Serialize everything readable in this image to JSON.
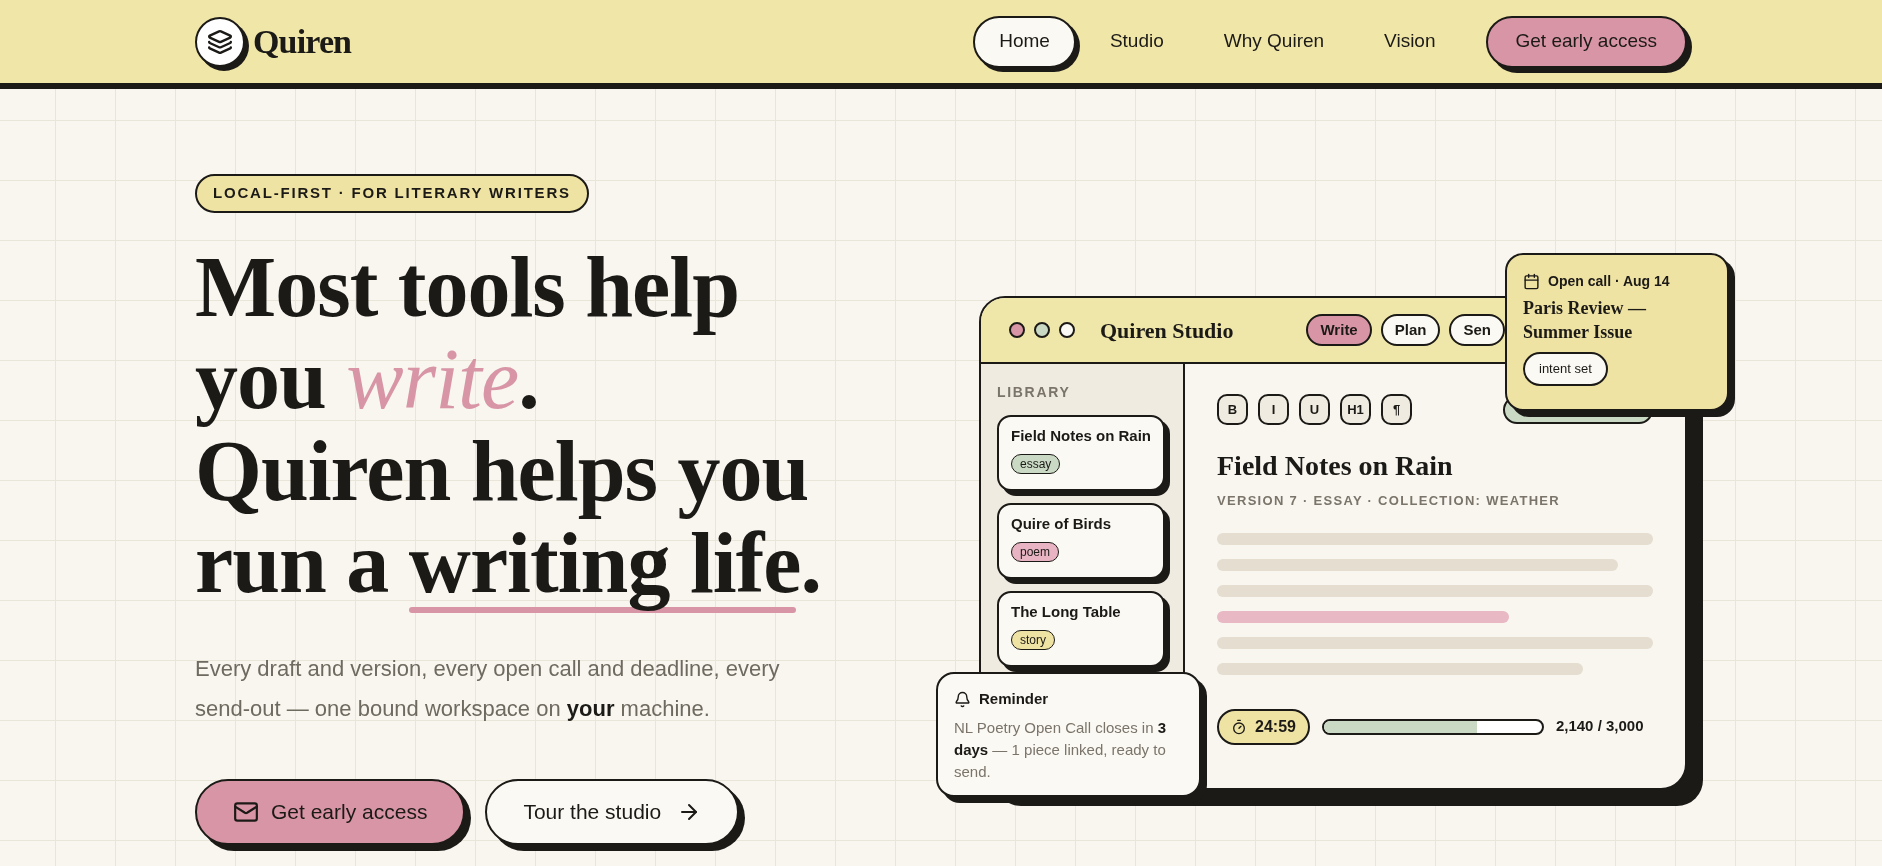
{
  "brand": {
    "name": "Quiren"
  },
  "nav": [
    {
      "label": "Home",
      "selected": true
    },
    {
      "label": "Studio",
      "selected": false
    },
    {
      "label": "Why Quiren",
      "selected": false
    },
    {
      "label": "Vision",
      "selected": false
    }
  ],
  "nav_cta": "Get early access",
  "hero": {
    "badge": "LOCAL-FIRST · FOR LITERARY WRITERS",
    "headline": [
      [
        {
          "text": "Most tools help you ",
          "kind": "plain"
        },
        {
          "text": "write",
          "kind": "accent"
        },
        {
          "text": ".",
          "kind": "plain"
        }
      ],
      [
        {
          "text": "Quiren helps you run a ",
          "kind": "plain"
        },
        {
          "text": "writing life",
          "kind": "underline"
        },
        {
          "text": ".",
          "kind": "plain"
        }
      ]
    ],
    "lead": "Every draft and version, every open call and deadline, every send-out — one bound workspace on **your** machine.",
    "buttons": [
      {
        "label": "Get early access",
        "kind": "primary"
      },
      {
        "label": "Tour the studio",
        "kind": "secondary"
      }
    ]
  },
  "studio": {
    "title": "Quiren Studio",
    "dots": [
      {
        "color": "#d895a6"
      },
      {
        "color": "#c9d9c4"
      },
      {
        "color": "#fbf9f3"
      }
    ],
    "tabs": [
      {
        "label": "Write",
        "selected": true
      },
      {
        "label": "Plan",
        "selected": false
      },
      {
        "label": "Sen",
        "selected": false
      }
    ],
    "library_label": "LIBRARY",
    "library": [
      {
        "title": "Field Notes on Rain",
        "tag": "essay",
        "color": "#c9d9c4"
      },
      {
        "title": "Quire of Birds",
        "tag": "poem",
        "color": "#e8b4c4"
      },
      {
        "title": "The Long Table",
        "tag": "story",
        "color": "#efe3a4"
      }
    ],
    "toolbar": [
      "B",
      "I",
      "U",
      "H1",
      "¶"
    ],
    "doc_title": "Field Notes on Rain",
    "doc_meta": "VERSION 7 · ESSAY · COLLECTION: WEATHER",
    "timer": "24:59",
    "word_goal": {
      "level": 0.7,
      "reading": "2,140 / 3,000"
    }
  },
  "open_call": {
    "date": "Open call · Aug 14",
    "title": "Paris Review — Summer Issue",
    "button": "intent set"
  },
  "reminder": {
    "title": "Reminder",
    "text": "NL Poetry Open Call closes in **3 days** — 1 piece linked, ready to send."
  }
}
